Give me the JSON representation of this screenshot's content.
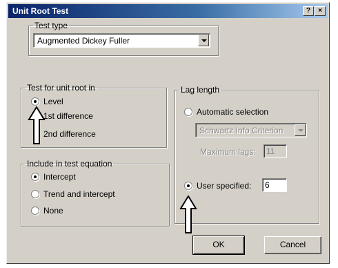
{
  "window": {
    "title": "Unit Root Test",
    "help_label": "?",
    "close_label": "×"
  },
  "test_type": {
    "legend": "Test type",
    "selected": "Augmented Dickey Fuller",
    "arrow_icon": "chevron-down-icon"
  },
  "unit_root": {
    "legend": "Test for unit root in",
    "options": [
      "Level",
      "1st difference",
      "2nd difference"
    ],
    "selected_index": 0
  },
  "include": {
    "legend": "Include in test equation",
    "options": [
      "Intercept",
      "Trend and intercept",
      "None"
    ],
    "selected_index": 0
  },
  "lag": {
    "legend": "Lag length",
    "automatic_label": "Automatic selection",
    "criterion": "Schwartz Info Criterion",
    "max_lags_label": "Maximum lags:",
    "max_lags_value": "11",
    "user_label": "User specified:",
    "user_value": "6",
    "selected": "user"
  },
  "buttons": {
    "ok": "OK",
    "cancel": "Cancel"
  },
  "annotations": {
    "arrow_icon": "up-arrow-icon",
    "arrow_color": "#ffffff",
    "outline_color": "#000000"
  }
}
